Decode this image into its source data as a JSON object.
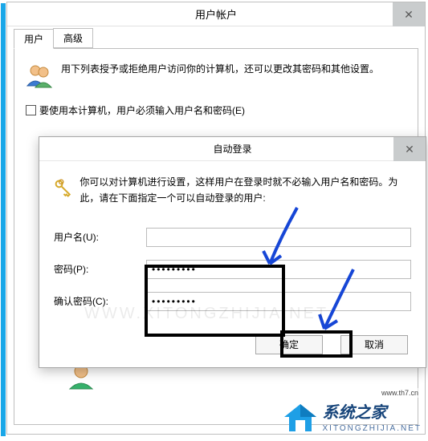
{
  "parent": {
    "title": "用户帐户",
    "tabs": [
      "用户",
      "高级"
    ],
    "active_tab": 0,
    "blurb": "用下列表授予或拒绝用户访问你的计算机，还可以更改其密码和其他设置。",
    "checkbox_label": "要使用本计算机，用户必须输入用户名和密码(E)"
  },
  "child": {
    "title": "自动登录",
    "blurb": "你可以对计算机进行设置，这样用户在登录时就不必输入用户名和密码。为此，请在下面指定一个可以自动登录的用户:",
    "username_label": "用户名(U):",
    "username_value": "",
    "password_label": "密码(P):",
    "password_value": "•••••••••",
    "confirm_label": "确认密码(C):",
    "confirm_value": "•••••••••",
    "ok": "确定",
    "cancel": "取消"
  },
  "watermarks": {
    "faint_url": "WWW.XITONGZHIJIA.NET",
    "brand_cn": "系统之家",
    "brand_py": "XITONGZHIJIA.NET",
    "th7": "www.th7.cn"
  },
  "icons": {
    "close": "✕"
  }
}
